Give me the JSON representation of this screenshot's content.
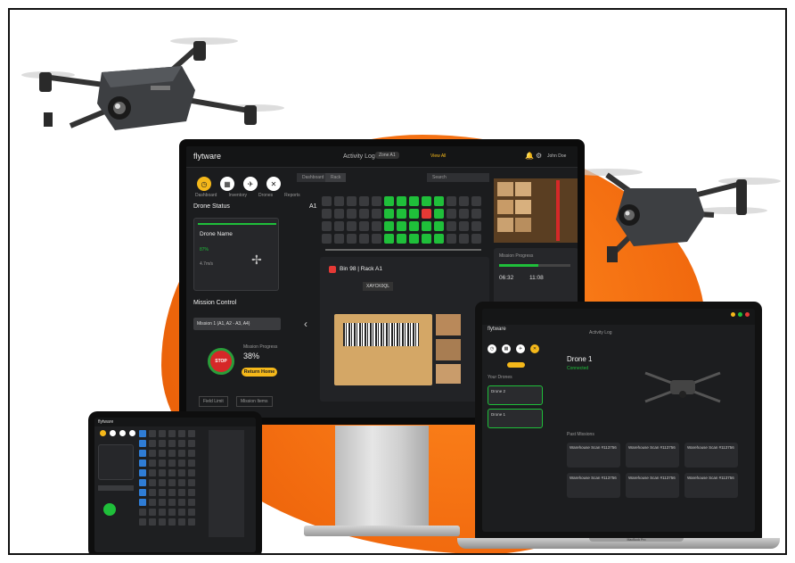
{
  "monitor": {
    "logo": "flytware",
    "topbar": {
      "title": "Activity Log",
      "user": "John Doe",
      "view": "View All",
      "chip": "Zone A1"
    },
    "nav": [
      "Dashboard",
      "Inventory",
      "Drones",
      "Reports"
    ],
    "drone_status": {
      "title": "Drone Status",
      "name": "Drone Name",
      "battery": "87%",
      "label2": "4.7m/s"
    },
    "tabs": [
      "Dashboard",
      "Rack"
    ],
    "search_placeholder": "Search",
    "row_label": "A1",
    "bin": {
      "title": "Bin 98 | Rack A1",
      "code": "XAYCK0QL"
    },
    "mission": {
      "title": "Mission Control",
      "select": "Mission 1 (A1, A2 - A3, A4)",
      "stop": "STOP",
      "percent": "38%",
      "progress_label": "Mission Progress",
      "return_btn": "Return Home",
      "footer1": "Field Limit",
      "footer2": "Mission Items"
    },
    "progress_card": {
      "title": "Mission Progress",
      "t1": "06:32",
      "t2": "11:08"
    }
  },
  "tablet": {
    "logo": "flytware"
  },
  "laptop": {
    "logo": "flytware",
    "title": "Activity Log",
    "drone": "Drone 1",
    "drone_sub": "Connected",
    "section": "Your Drones",
    "item1": "Drone 1",
    "item2": "Drone 2",
    "missions_title": "Past Missions",
    "mission_card": "Warehouse Scan #113756",
    "base_label": "MacBook Pro"
  }
}
